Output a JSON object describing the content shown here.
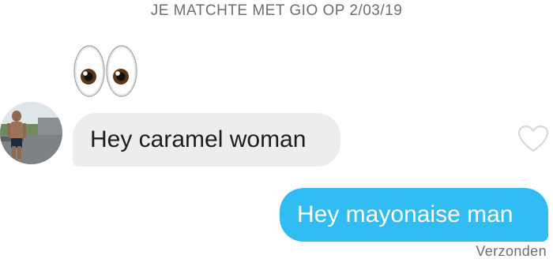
{
  "header": {
    "match_text": "JE MATCHTE MET GIO OP 2/03/19"
  },
  "conversation": {
    "emoji_message": {
      "icon": "eyes-emoji",
      "glyph": "👀"
    },
    "received_message": {
      "text": "Hey caramel woman"
    },
    "sent_message": {
      "text": "Hey mayonaise man",
      "status": "Verzonden"
    }
  },
  "colors": {
    "sent_bubble": "#31bdf3",
    "received_bubble": "#ededed",
    "meta_text": "#6e6e6e"
  }
}
